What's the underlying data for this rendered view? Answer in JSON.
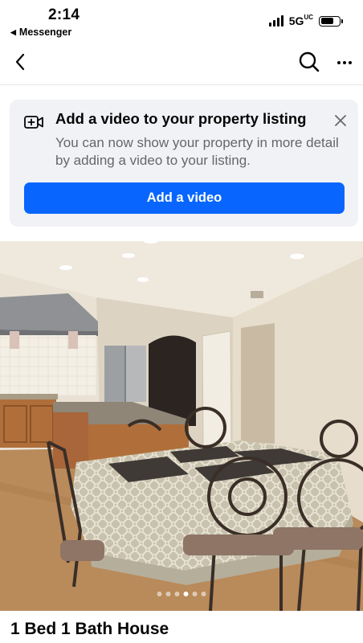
{
  "status_bar": {
    "time": "2:14",
    "back_app": "Messenger",
    "network": "5G",
    "network_suffix": "UC",
    "battery_level": 0.75
  },
  "nav": {
    "back_icon": "chevron-left-icon",
    "search_icon": "search-icon",
    "more_icon": "more-horizontal-icon"
  },
  "promo_card": {
    "icon": "video-plus-icon",
    "title": "Add a video to your property listing",
    "body": "You can now show your property in more detail by adding a video to your listing.",
    "button_label": "Add a video",
    "close_icon": "close-icon",
    "accent_color": "#0866ff"
  },
  "photo_carousel": {
    "image_description": "dining room with kitchen",
    "dot_count": 6,
    "active_index": 3
  },
  "listing": {
    "title": "1 Bed 1 Bath House"
  }
}
